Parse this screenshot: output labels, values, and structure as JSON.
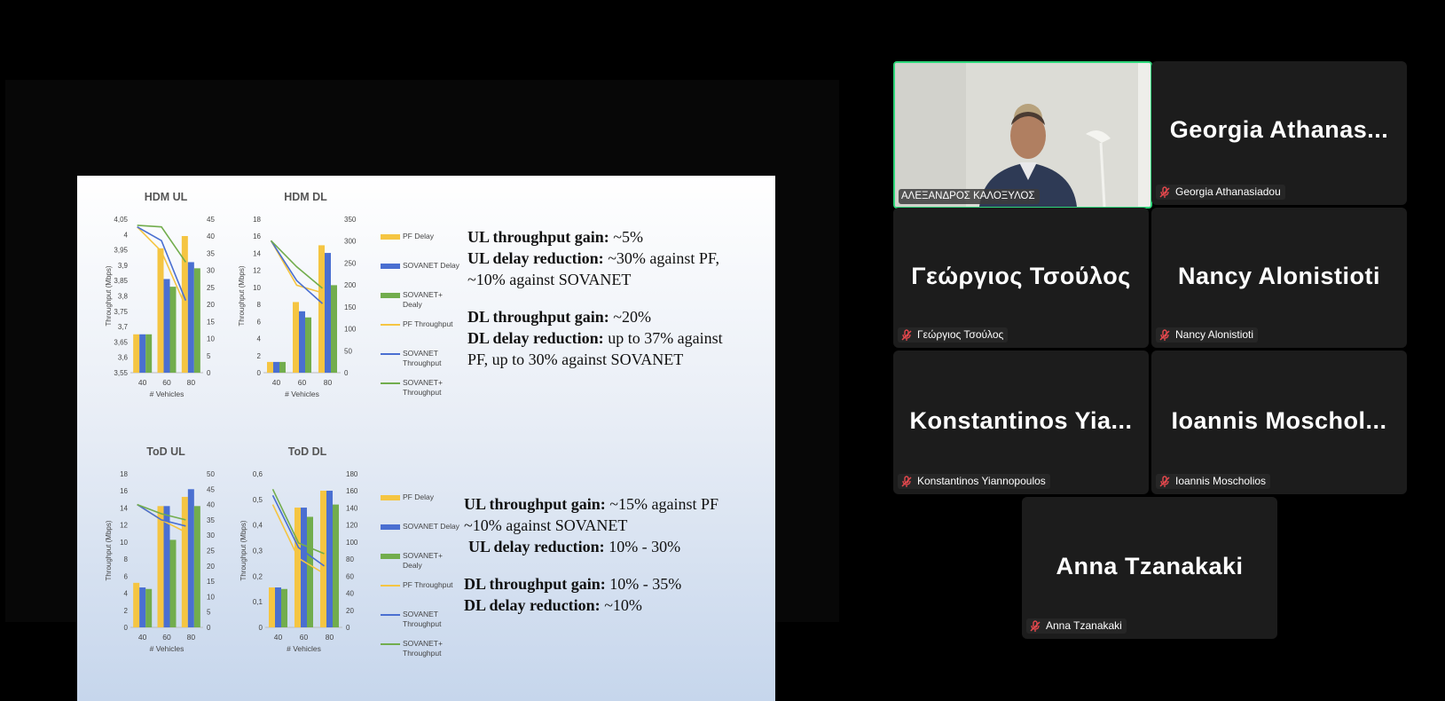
{
  "slide": {
    "hdm_ul": {
      "title": "HDM UL",
      "y_left": [
        "4,05",
        "4",
        "3,95",
        "3,9",
        "3,85",
        "3,8",
        "3,75",
        "3,7",
        "3,65",
        "3,6",
        "3,55"
      ],
      "y_right": [
        "45",
        "40",
        "35",
        "30",
        "25",
        "20",
        "15",
        "10",
        "5",
        "0"
      ],
      "ylabel": "Throughput (Mbps)",
      "x": [
        "40",
        "60",
        "80"
      ],
      "xlabel": "# Vehicles"
    },
    "hdm_dl": {
      "title": "HDM DL",
      "y_left": [
        "18",
        "16",
        "14",
        "12",
        "10",
        "8",
        "6",
        "4",
        "2",
        "0"
      ],
      "y_right": [
        "350",
        "300",
        "250",
        "200",
        "150",
        "100",
        "50",
        "0"
      ],
      "ylabel": "Throughput (Mbps)",
      "x": [
        "40",
        "60",
        "80"
      ],
      "xlabel": "# Vehicles"
    },
    "tod_ul": {
      "title": "ToD UL",
      "y_left": [
        "18",
        "16",
        "14",
        "12",
        "10",
        "8",
        "6",
        "4",
        "2",
        "0"
      ],
      "y_right": [
        "50",
        "45",
        "40",
        "35",
        "30",
        "25",
        "20",
        "15",
        "10",
        "5",
        "0"
      ],
      "ylabel": "Throughput (Mbps)",
      "x": [
        "40",
        "60",
        "80"
      ],
      "xlabel": "# Vehicles"
    },
    "tod_dl": {
      "title": "ToD DL",
      "y_left": [
        "0,6",
        "0,5",
        "0,4",
        "0,3",
        "0,2",
        "0,1",
        "0"
      ],
      "y_right": [
        "180",
        "160",
        "140",
        "120",
        "100",
        "80",
        "60",
        "40",
        "20",
        "0"
      ],
      "ylabel": "Throughput (Mbps)",
      "x": [
        "40",
        "60",
        "80"
      ],
      "xlabel": "# Vehicles"
    },
    "legend": [
      {
        "label": "PF Delay",
        "type": "bar",
        "color": "#f5c542"
      },
      {
        "label": "SOVANET Delay",
        "type": "bar",
        "color": "#4a6fd1"
      },
      {
        "label": "SOVANET+ Dealy",
        "type": "bar",
        "color": "#72ad4d"
      },
      {
        "label": "PF Throughput",
        "type": "line",
        "color": "#f5c542"
      },
      {
        "label": "SOVANET Throughput",
        "type": "line",
        "color": "#4a6fd1"
      },
      {
        "label": "SOVANET+ Throughput",
        "type": "line",
        "color": "#72ad4d"
      }
    ],
    "hdm_text": {
      "ul_tp_label": "UL throughput gain:",
      "ul_tp_value": " ~5%",
      "ul_delay_label": "UL delay reduction:",
      "ul_delay_value": " ~30% against PF,",
      "ul_delay_line2": "~10% against SOVANET",
      "dl_tp_label": "DL throughput gain:",
      "dl_tp_value": " ~20%",
      "dl_delay_label": "DL delay reduction:",
      "dl_delay_value": " up to 37% against",
      "dl_delay_line2": "PF, up to 30% against SOVANET"
    },
    "tod_text": {
      "ul_tp_label": "UL throughput gain:",
      "ul_tp_value": " ~15% against PF",
      "ul_tp_line2": "~10% against SOVANET",
      "ul_delay_label": "UL delay reduction:",
      "ul_delay_value": " 10% - 30%",
      "dl_tp_label": "DL throughput gain:",
      "dl_tp_value": " 10% - 35%",
      "dl_delay_label": "DL delay reduction:",
      "dl_delay_value": " ~10%"
    }
  },
  "participants": {
    "speaker_tag": "ΑΛΕΞΑΝΔΡΟΣ ΚΑΛΟΞΥΛΟΣ",
    "georgia": {
      "big": "Georgia  Athanas...",
      "tag": "Georgia Athanasiadou"
    },
    "georgios": {
      "big": "Γεώργιος Τσούλος",
      "tag": "Γεώργιος Τσούλος"
    },
    "nancy": {
      "big": "Nancy Alonistioti",
      "tag": "Nancy Alonistioti"
    },
    "konstantinos": {
      "big": "Konstantinos  Yia...",
      "tag": "Konstantinos Yiannopoulos"
    },
    "ioannis": {
      "big": "Ioannis  Moschol...",
      "tag": "Ioannis Moscholios"
    },
    "anna": {
      "big": "Anna Tzanakaki",
      "tag": "Anna Tzanakaki"
    }
  },
  "colors": {
    "active_speaker_border": "#2ed67a",
    "mute_icon": "#e5484d",
    "tile_bg": "#1c1c1c"
  }
}
